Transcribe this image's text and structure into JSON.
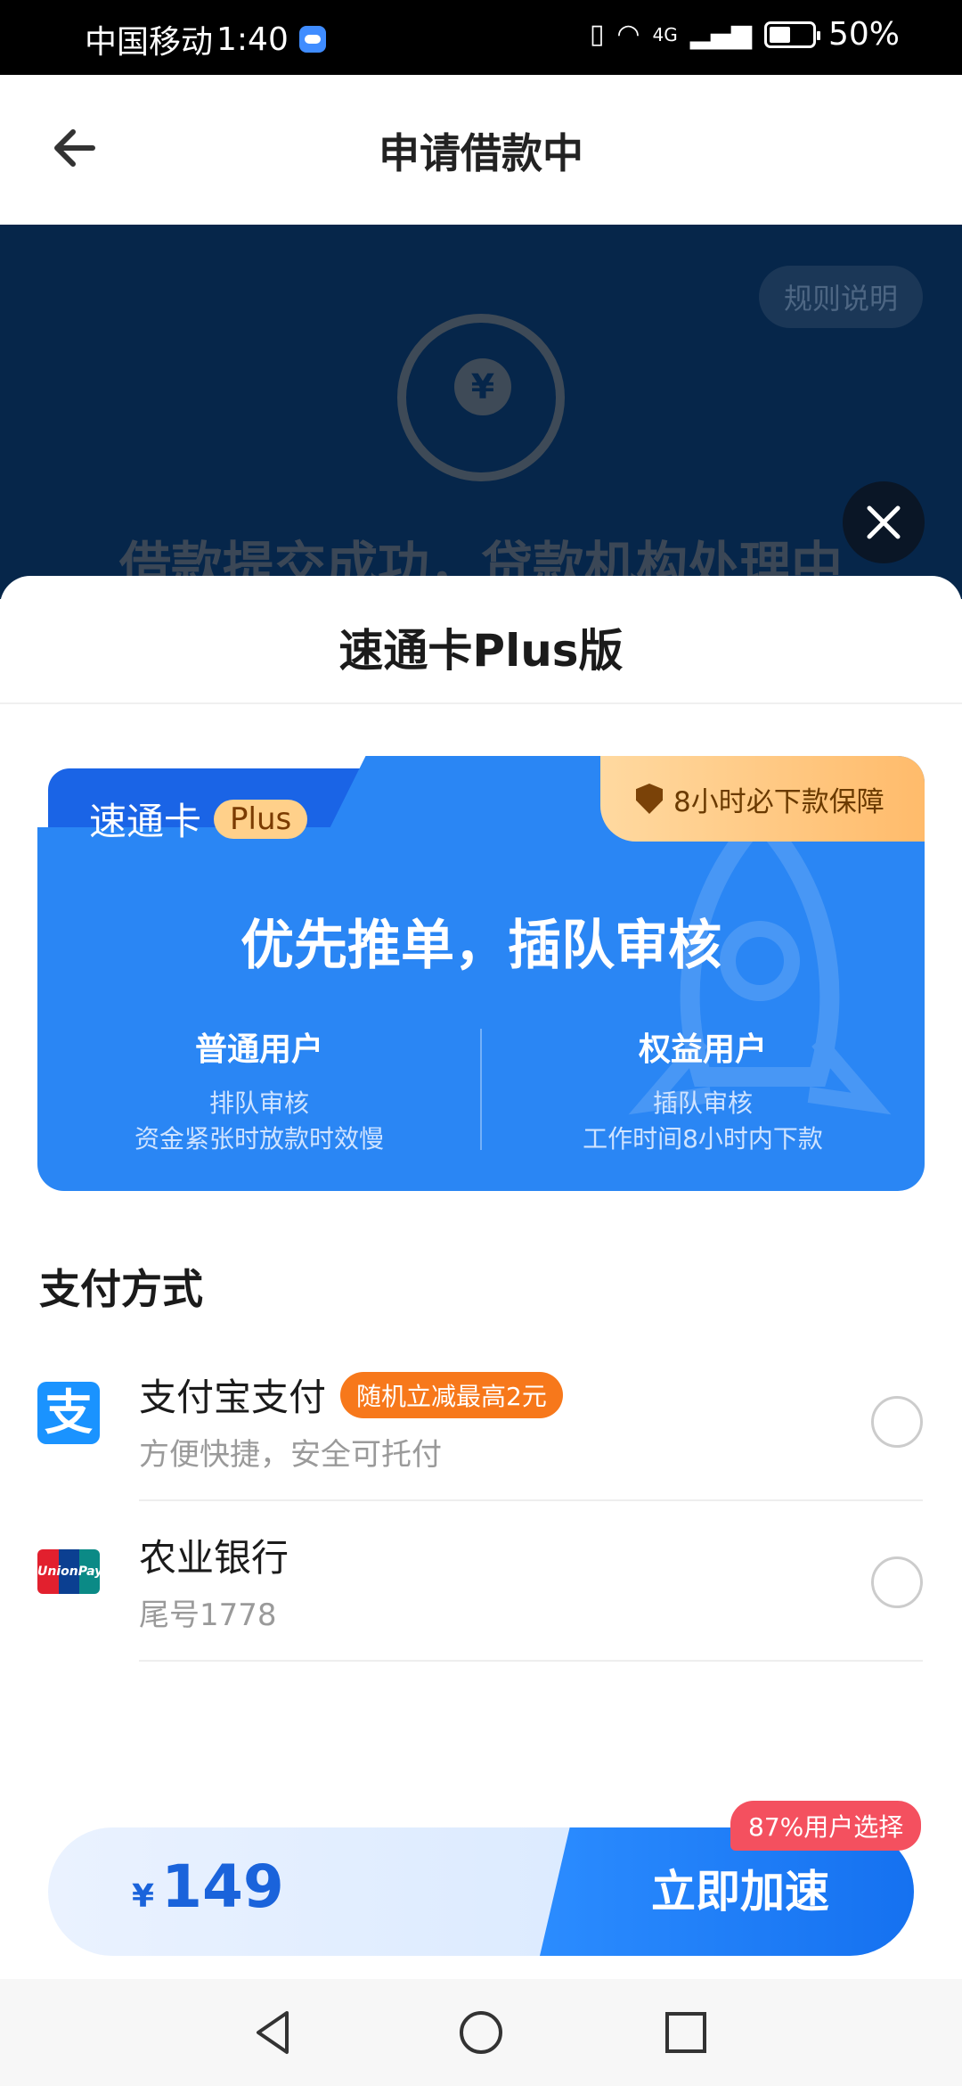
{
  "status_bar": {
    "carrier": "中国移动",
    "time": "1:40",
    "network": "4G",
    "battery": "50%"
  },
  "header": {
    "title": "申请借款中"
  },
  "background": {
    "rules_label": "规则说明",
    "status_text": "借款提交成功，贷款机构处理中"
  },
  "sheet": {
    "title": "速通卡Plus版",
    "card": {
      "tab_label": "速通卡",
      "plus_label": "Plus",
      "guarantee": "8小时必下款保障",
      "headline": "优先推单，插队审核",
      "left": {
        "title": "普通用户",
        "line1": "排队审核",
        "line2": "资金紧张时放款时效慢"
      },
      "right": {
        "title": "权益用户",
        "line1": "插队审核",
        "line2": "工作时间8小时内下款"
      }
    },
    "payment": {
      "title": "支付方式",
      "methods": [
        {
          "name": "支付宝支付",
          "badge": "随机立减最高2元",
          "sub": "方便快捷，安全可托付",
          "icon": "alipay-icon"
        },
        {
          "name": "农业银行",
          "sub": "尾号1778",
          "icon": "unionpay-icon"
        }
      ]
    }
  },
  "action": {
    "currency": "¥",
    "price": "149",
    "cta": "立即加速",
    "badge": "87%用户选择"
  },
  "colors": {
    "primary": "#2a86f4",
    "dark_overlay": "#06264a",
    "promo_orange": "#f7781b",
    "badge_red": "#f4505f"
  }
}
